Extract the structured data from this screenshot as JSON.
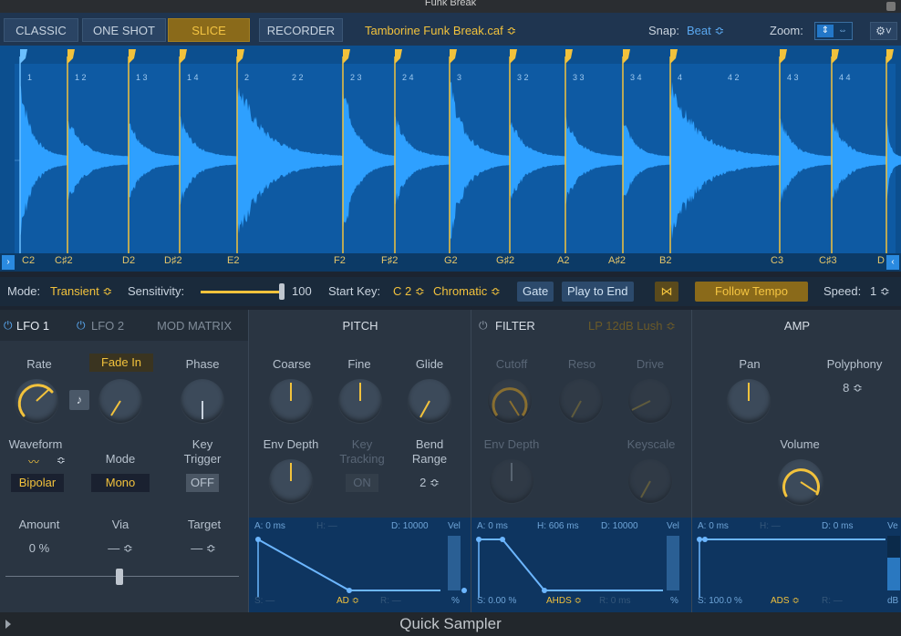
{
  "window": {
    "title": "Funk Break",
    "footer_title": "Quick Sampler"
  },
  "modes": [
    "CLASSIC",
    "ONE SHOT",
    "SLICE"
  ],
  "active_mode": "SLICE",
  "recorder_label": "RECORDER",
  "file_name": "Tamborine Funk Break.caf ≎",
  "snap": {
    "label": "Snap:",
    "value": "Beat ≎"
  },
  "zoom": {
    "label": "Zoom:"
  },
  "slice_keys": [
    "C2",
    "C♯2",
    "D2",
    "D♯2",
    "E2",
    "F2",
    "F♯2",
    "G2",
    "G♯2",
    "A2",
    "A♯2",
    "B2",
    "C3",
    "C♯3",
    "D"
  ],
  "ruler": [
    "1",
    "1 2",
    "1 3",
    "1 4",
    "2",
    "2 2",
    "2 3",
    "2 4",
    "3",
    "3 2",
    "3 3",
    "3 4",
    "4",
    "4 2",
    "4 3",
    "4 4"
  ],
  "controls": {
    "mode_label": "Mode:",
    "mode_value": "Transient ≎",
    "sensitivity_label": "Sensitivity:",
    "sensitivity_value": "100",
    "start_key_label": "Start Key:",
    "start_key_value": "C 2 ≎",
    "scale_value": "Chromatic ≎",
    "gate": "Gate",
    "play_to_end": "Play to End",
    "follow_tempo": "Follow Tempo",
    "speed_label": "Speed:",
    "speed_value": "1 ≎"
  },
  "lfo": {
    "tabs": [
      "LFO 1",
      "LFO 2",
      "MOD MATRIX"
    ],
    "rate": "Rate",
    "fade_in": "Fade In",
    "phase": "Phase",
    "waveform": "Waveform",
    "waveform_value": "Bipolar",
    "mode": "Mode",
    "mode_value": "Mono",
    "key_trigger": "Key\nTrigger",
    "key_trigger_value": "OFF",
    "amount": "Amount",
    "amount_value": "0 %",
    "via": "Via",
    "via_value": "— ≎",
    "target": "Target",
    "target_value": "— ≎"
  },
  "pitch": {
    "title": "PITCH",
    "coarse": "Coarse",
    "fine": "Fine",
    "glide": "Glide",
    "env_depth": "Env Depth",
    "key_tracking": "Key\nTracking",
    "key_tracking_value": "ON",
    "bend_range": "Bend\nRange",
    "bend_range_value": "2 ≎",
    "env": {
      "a": "A: 0 ms",
      "h": "H: —",
      "d": "D: 10000",
      "vel": "Vel",
      "s": "S: —",
      "type": "AD ≎",
      "r": "R: —",
      "pct": "%"
    }
  },
  "filter": {
    "title": "FILTER",
    "type": "LP 12dB Lush ≎",
    "cutoff": "Cutoff",
    "reso": "Reso",
    "drive": "Drive",
    "env_depth": "Env Depth",
    "keyscale": "Keyscale",
    "env": {
      "a": "A: 0 ms",
      "h": "H: 606 ms",
      "d": "D: 10000",
      "vel": "Vel",
      "s": "S: 0.00 %",
      "type": "AHDS ≎",
      "r": "R: 0 ms",
      "pct": "%"
    }
  },
  "amp": {
    "title": "AMP",
    "pan": "Pan",
    "polyphony": "Polyphony",
    "polyphony_value": "8 ≎",
    "volume": "Volume",
    "env": {
      "a": "A: 0 ms",
      "h": "H: —",
      "d": "D: 0 ms",
      "vel": "Ve",
      "s": "S: 100.0 %",
      "type": "ADS ≎",
      "r": "R: —",
      "db": "dB"
    }
  },
  "colors": {
    "accent": "#f2c23c",
    "waveform": "#2ea0ff",
    "panel": "#2a3542",
    "highlight_blue": "#5aa8f0"
  }
}
